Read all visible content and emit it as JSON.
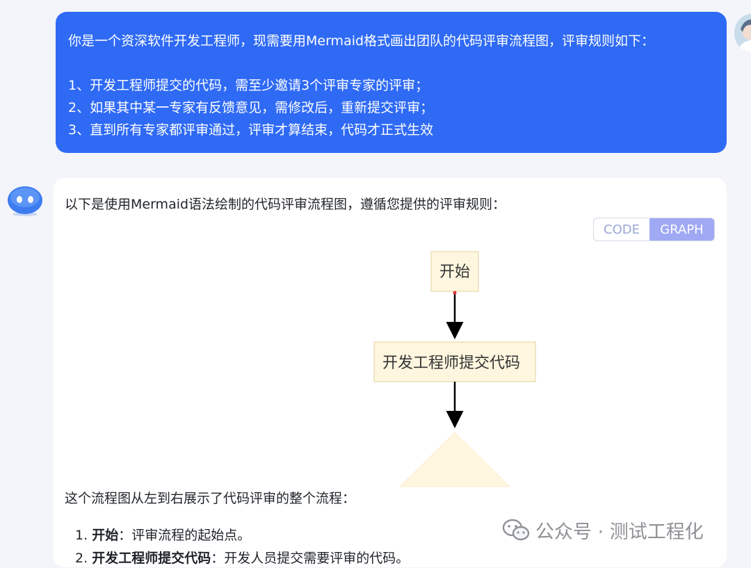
{
  "user_message": {
    "intro": "你是一个资深软件开发工程师，现需要用Mermaid格式画出团队的代码评审流程图，评审规则如下：",
    "rules": [
      "1、开发工程师提交的代码，需至少邀请3个评审专家的评审；",
      "2、如果其中某一专家有反馈意见，需修改后，重新提交评审；",
      "3、直到所有专家都评审通过，评审才算结束，代码才正式生效"
    ]
  },
  "answer": {
    "intro": "以下是使用Mermaid语法绘制的代码评审流程图，遵循您提供的评审规则：",
    "toggle": {
      "code": "CODE",
      "graph": "GRAPH",
      "selected": "graph"
    },
    "diagram": {
      "nodes": [
        {
          "id": "start",
          "label": "开始",
          "shape": "rect"
        },
        {
          "id": "submit",
          "label": "开发工程师提交代码",
          "shape": "rect"
        },
        {
          "id": "decision",
          "label": "",
          "shape": "diamond"
        }
      ],
      "colors": {
        "fill": "#fff6df",
        "stroke": "#e6d8ab",
        "edge": "#000000",
        "dot": "#e03030"
      }
    },
    "summary": "这个流程图从左到右展示了代码评审的整个流程：",
    "list": [
      {
        "number": "1.",
        "term": "开始",
        "desc": "：评审流程的起始点。"
      },
      {
        "number": "2.",
        "term": "开发工程师提交代码",
        "desc": "：开发人员提交需要评审的代码。"
      }
    ]
  },
  "watermark": {
    "text": "公众号 · 测试工程化",
    "icon": "wechat-icon"
  },
  "colors": {
    "user_bubble": "#2f6af5",
    "background": "#f4f5fa",
    "toggle_active": "#9fa9f4"
  }
}
